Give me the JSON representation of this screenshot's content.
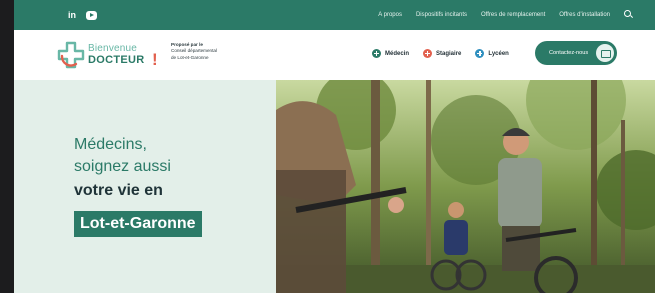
{
  "topbar": {
    "social": [
      {
        "icon": "linkedin-icon",
        "label": "in"
      },
      {
        "icon": "youtube-icon",
        "label": ""
      }
    ],
    "links": [
      "A propos",
      "Dispositifs incitants",
      "Offres de remplacement",
      "Offres d'installation"
    ],
    "search_icon": "search-icon"
  },
  "header": {
    "logo": {
      "line1": "Bienvenue",
      "line2": "DOCTEUR",
      "mark": "!"
    },
    "proposed_by": {
      "intro": "Proposé par le",
      "line2": "Conseil départemental",
      "line3": "de Lot-et-Garonne"
    },
    "categories": [
      {
        "label": "Médecin",
        "color": "#2b7a67"
      },
      {
        "label": "Stagiaire",
        "color": "#e2604e"
      },
      {
        "label": "Lycéen",
        "color": "#2f8fbf"
      }
    ],
    "contact_label": "Contactez-nous"
  },
  "hero": {
    "line1": "Médecins,",
    "line2": "soignez aussi",
    "line3": "votre vie en",
    "highlight": "Lot-et-Garonne"
  },
  "colors": {
    "brand": "#2b7a67",
    "accent": "#e2604e",
    "hero_bg": "#e3efe9"
  }
}
